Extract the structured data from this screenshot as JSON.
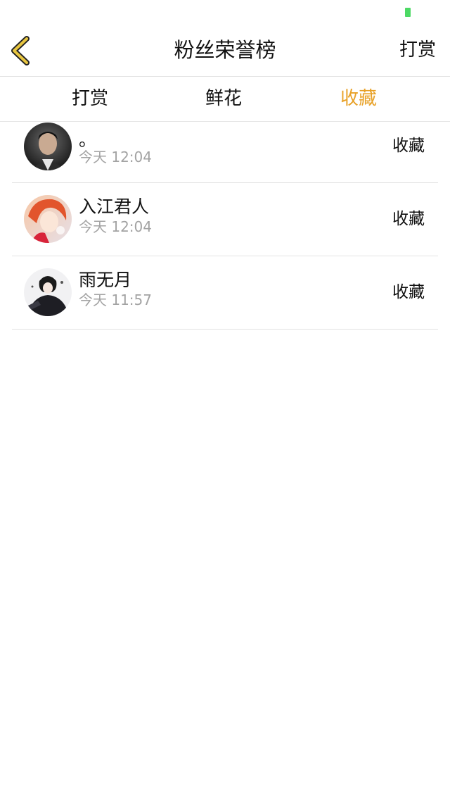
{
  "status_bar": {
    "battery_color": "#4cd964"
  },
  "nav": {
    "back_icon": "chevron-left-icon",
    "back_color": "#e8c640",
    "title": "粉丝荣誉榜",
    "right_label": "打赏"
  },
  "tabs": [
    {
      "label": "打赏",
      "active": false
    },
    {
      "label": "鲜花",
      "active": false
    },
    {
      "label": "收藏",
      "active": true
    }
  ],
  "accent_color": "#e8a127",
  "fans": [
    {
      "name": "。",
      "time": "今天 12:04",
      "action": "收藏",
      "avatar": "avatar-man-dark"
    },
    {
      "name": "入江君人",
      "time": "今天 12:04",
      "action": "收藏",
      "avatar": "avatar-anime-redhair"
    },
    {
      "name": "雨无月",
      "time": "今天 11:57",
      "action": "收藏",
      "avatar": "avatar-anime-dark"
    }
  ]
}
